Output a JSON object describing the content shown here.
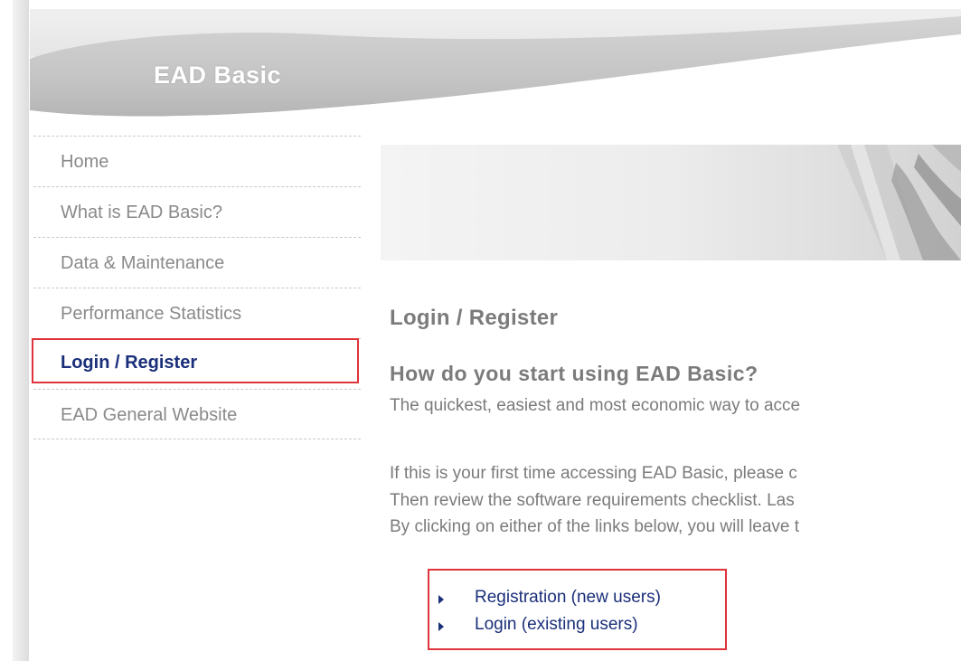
{
  "header": {
    "logo_text": "EAD Basic"
  },
  "sidebar": {
    "items": [
      {
        "label": "Home",
        "active": false
      },
      {
        "label": "What is EAD Basic?",
        "active": false
      },
      {
        "label": "Data & Maintenance",
        "active": false
      },
      {
        "label": "Performance Statistics",
        "active": false
      },
      {
        "label": "Login / Register",
        "active": true
      },
      {
        "label": "EAD General Website",
        "active": false
      }
    ]
  },
  "main": {
    "title": "Login / Register",
    "heading": "How do you start using EAD Basic?",
    "lead": "The quickest, easiest and most economic way to acce",
    "paragraph_lines": [
      "If this is your first time accessing EAD Basic, please c",
      "Then review the software requirements checklist. Las",
      "By clicking on either of the links below, you will leave t"
    ],
    "links": [
      {
        "label": "Registration (new users)",
        "icon": "right-arrow-icon"
      },
      {
        "label": "Login (existing users)",
        "icon": "right-arrow-icon"
      }
    ]
  },
  "colors": {
    "nav_text": "#8a8a8a",
    "nav_active": "#1a2f7a",
    "highlight_border": "#e0333b",
    "body_text": "#7b7b7b",
    "link": "#1a2f7a"
  }
}
